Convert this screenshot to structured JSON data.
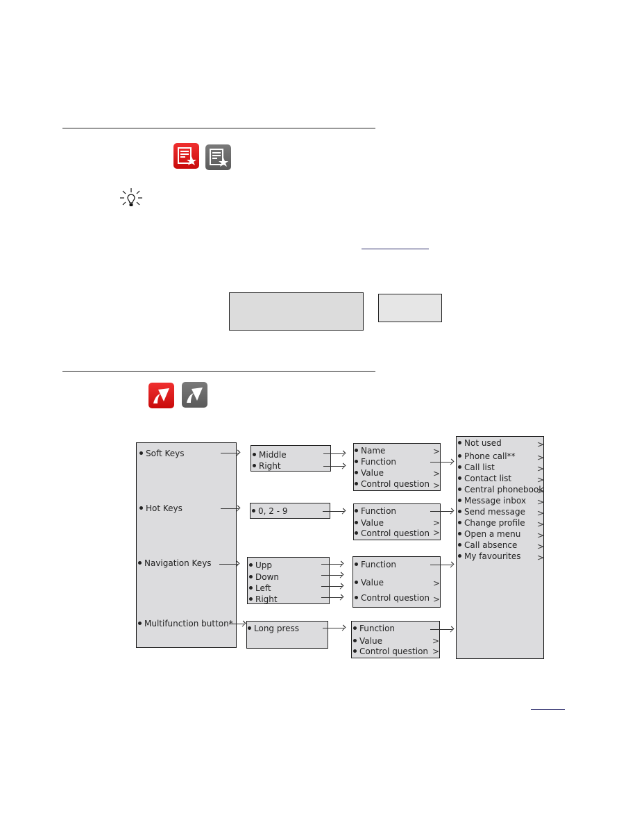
{
  "icons": {
    "favourites_active": "favourites-icon-red",
    "favourites_inactive": "favourites-icon-gray",
    "tip": "lightbulb-icon",
    "keys_active": "keys-icon-red",
    "keys_inactive": "keys-icon-gray"
  },
  "colors": {
    "accent_red": "#e01818",
    "icon_gray": "#6a6a6a",
    "box_fill": "#dcdcde",
    "link": "#2a2a6a"
  },
  "diagram": {
    "col1": [
      "Soft Keys",
      "Hot Keys",
      "Navigation Keys",
      "Multifunction button*"
    ],
    "col2": {
      "soft": [
        "Middle",
        "Right"
      ],
      "hot": [
        "0, 2 - 9"
      ],
      "nav": [
        "Upp",
        "Down",
        "Left",
        "Right"
      ],
      "multi": [
        "Long press"
      ]
    },
    "col3": {
      "soft": [
        "Name",
        "Function",
        "Value",
        "Control question"
      ],
      "hot": [
        "Function",
        "Value",
        "Control question"
      ],
      "nav": [
        "Function",
        "Value",
        "Control question"
      ],
      "multi": [
        "Function",
        "Value",
        "Control question"
      ]
    },
    "col4": [
      "Not used",
      "Phone call**",
      "Call list",
      "Contact list",
      "Central phonebook",
      "Message inbox",
      "Send message",
      "Change profile",
      "Open a menu",
      "Call absence",
      "My favourites"
    ],
    "gt": ">"
  }
}
